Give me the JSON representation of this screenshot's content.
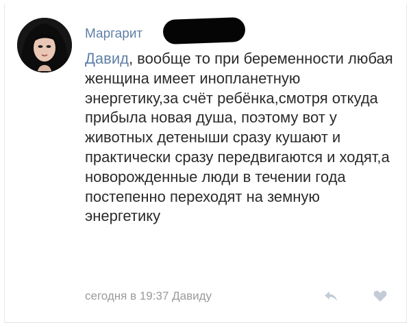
{
  "comment": {
    "author_visible": "Маргарит",
    "reply_to": "Давид",
    "text_after_reply": ", вообще то при беременности любая женщина имеет инопланетную энергетику,за счёт ребёнка,смотря откуда прибыла новая душа, поэтому вот у животных детеныши сразу кушают и практически сразу передвигаются и ходят,а новорожденные люди в течении года постепенно переходят на земную энергетику",
    "timestamp": "сегодня в 19:37",
    "reply_target": "Давиду"
  },
  "icons": {
    "reply": "reply-arrow-icon",
    "like": "heart-icon"
  },
  "colors": {
    "link": "#5f7fa6",
    "text": "#2a2a2a",
    "meta": "#9a9a9a",
    "icon": "#c3ccd6",
    "redaction": "#050505"
  }
}
